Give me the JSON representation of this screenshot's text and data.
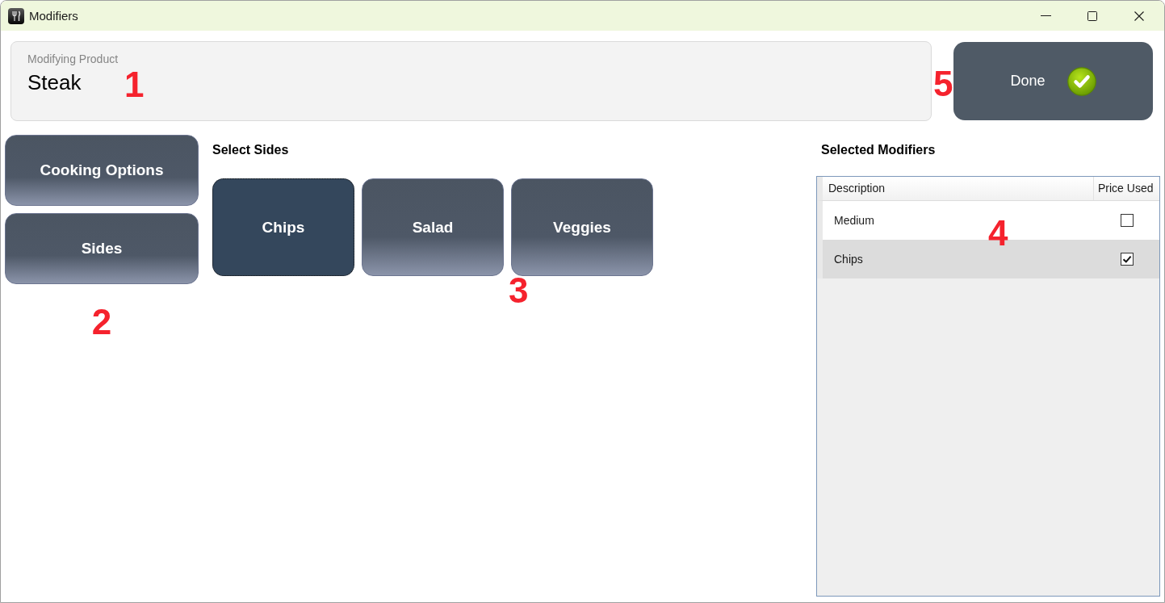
{
  "window": {
    "title": "Modifiers"
  },
  "product": {
    "label": "Modifying Product",
    "name": "Steak",
    "callout": "1"
  },
  "done_button": {
    "label": "Done",
    "callout": "5"
  },
  "categories": {
    "items": [
      {
        "label": "Cooking Options"
      },
      {
        "label": "Sides"
      }
    ],
    "callout": "2"
  },
  "options": {
    "title": "Select Sides",
    "items": [
      {
        "label": "Chips",
        "selected": true
      },
      {
        "label": "Salad",
        "selected": false
      },
      {
        "label": "Veggies",
        "selected": false
      }
    ],
    "callout": "3"
  },
  "selected_modifiers": {
    "title": "Selected Modifiers",
    "columns": [
      "Description",
      "Price Used"
    ],
    "rows": [
      {
        "description": "Medium",
        "price_used": false,
        "selected": false
      },
      {
        "description": "Chips",
        "price_used": true,
        "selected": true
      }
    ],
    "callout": "4"
  }
}
